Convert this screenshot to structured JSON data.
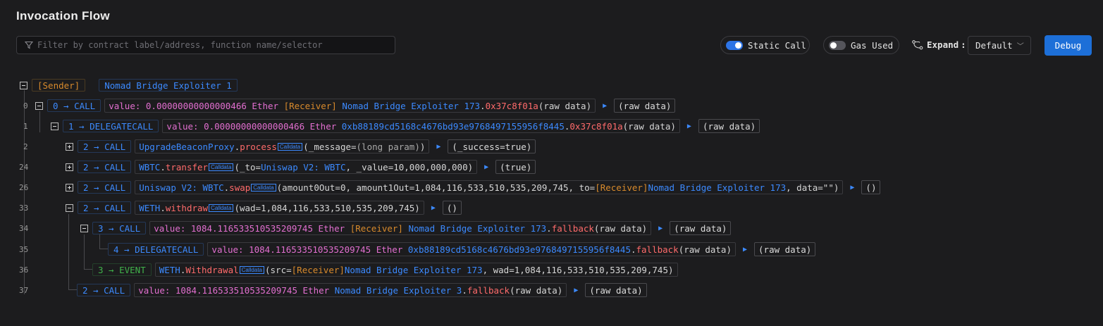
{
  "title": "Invocation Flow",
  "filter": {
    "placeholder": "Filter by contract label/address, function name/selector"
  },
  "toolbar": {
    "static_call": "Static Call",
    "gas_used": "Gas Used",
    "expand_label": "Expand",
    "expand_sep": ":",
    "expand_value": "Default",
    "debug": "Debug"
  },
  "colors": {
    "accent": "#1d6fd8",
    "call": "#3c8aff",
    "event": "#40b24a",
    "value": "#e26fd0",
    "receiver": "#d88a2c",
    "function": "#ff6b6b"
  },
  "root": {
    "sender": "[Sender]",
    "label": "Nomad Bridge Exploiter 1"
  },
  "calldata_badge": "Calldata",
  "rows": {
    "r0": {
      "ln": "0",
      "tag": "0 → CALL",
      "value": "value: 0.00000000000000466 Ether",
      "recv": "[Receiver]",
      "target": "Nomad Bridge Exploiter 173",
      "dot": ".",
      "fn": "0x37c8f01a",
      "args": "(raw data)",
      "result": "(raw data)"
    },
    "r1": {
      "ln": "1",
      "tag": "1 → DELEGATECALL",
      "value": "value: 0.00000000000000466 Ether",
      "target": "0xb88189cd5168c4676bd93e9768497155956f8445",
      "dot": ".",
      "fn": "0x37c8f01a",
      "args": "(raw data)",
      "result": "(raw data)"
    },
    "r2": {
      "ln": "2",
      "tag": "2 → CALL",
      "target": "UpgradeBeaconProxy",
      "dot": ".",
      "fn": "process",
      "args_pre": "(_message=",
      "args_val": "(long param)",
      "args_post": ")",
      "result": "(_success=true)"
    },
    "r24": {
      "ln": "24",
      "tag": "2 → CALL",
      "target": "WBTC",
      "dot": ".",
      "fn": "transfer",
      "args_pre": "(_to=",
      "args_link": "Uniswap V2: WBTC",
      "args_post": ", _value=10,000,000,000)",
      "result": "(true)"
    },
    "r26": {
      "ln": "26",
      "tag": "2 → CALL",
      "target": "Uniswap V2: WBTC",
      "dot": ".",
      "fn": "swap",
      "args_pre": "(amount0Out=0, amount1Out=1,084,116,533,510,535,209,745, to=",
      "args_recv": "[Receiver]",
      "args_link": "Nomad Bridge Exploiter 173",
      "args_post": ", data=\"\")",
      "result": "()"
    },
    "r33": {
      "ln": "33",
      "tag": "2 → CALL",
      "target": "WETH",
      "dot": ".",
      "fn": "withdraw",
      "args": "(wad=1,084,116,533,510,535,209,745)",
      "result": "()"
    },
    "r34": {
      "ln": "34",
      "tag": "3 → CALL",
      "value": "value: 1084.116533510535209745 Ether",
      "recv": "[Receiver]",
      "target": "Nomad Bridge Exploiter 173",
      "dot": ".",
      "fn": "fallback",
      "args": "(raw data)",
      "result": "(raw data)"
    },
    "r35": {
      "ln": "35",
      "tag": "4 → DELEGATECALL",
      "value": "value: 1084.116533510535209745 Ether",
      "target": "0xb88189cd5168c4676bd93e9768497155956f8445",
      "dot": ".",
      "fn": "fallback",
      "args": "(raw data)",
      "result": "(raw data)"
    },
    "r36": {
      "ln": "36",
      "tag": "3 → EVENT",
      "target": "WETH",
      "dot": ".",
      "fn": "Withdrawal",
      "args_pre": "(src=",
      "args_recv": "[Receiver]",
      "args_link": "Nomad Bridge Exploiter 173",
      "args_post": ", wad=1,084,116,533,510,535,209,745)"
    },
    "r37": {
      "ln": "37",
      "tag": "2 → CALL",
      "value": "value: 1084.116533510535209745 Ether",
      "target": "Nomad Bridge Exploiter 3",
      "dot": ".",
      "fn": "fallback",
      "args": "(raw data)",
      "result": "(raw data)"
    }
  }
}
